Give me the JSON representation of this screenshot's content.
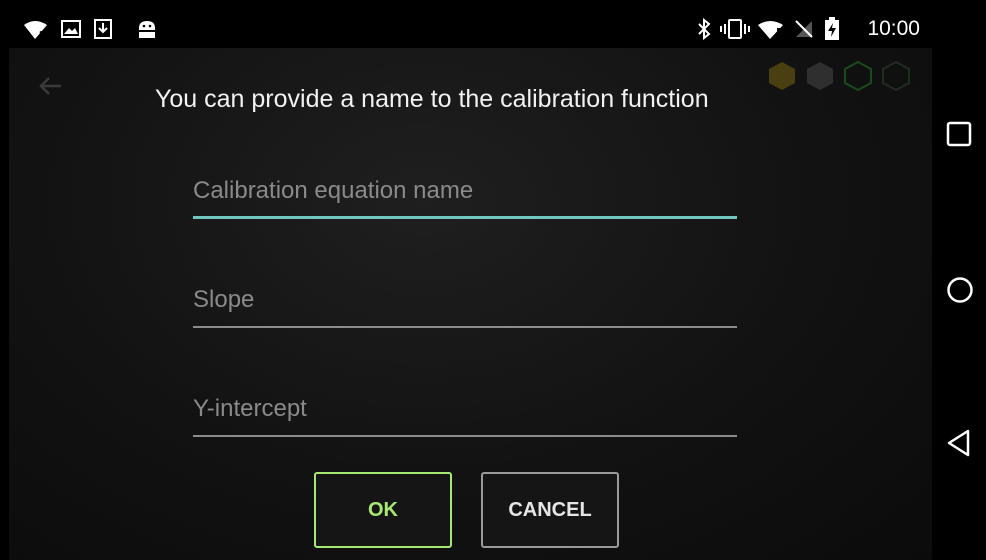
{
  "status_bar": {
    "time": "10:00",
    "left_icons": [
      "wifi-question-icon",
      "image-icon",
      "download-icon",
      "android-debug-icon"
    ],
    "right_icons": [
      "bluetooth-icon",
      "vibrate-icon",
      "wifi-alert-icon",
      "no-sim-icon",
      "battery-charging-icon"
    ]
  },
  "dialog": {
    "prompt": "You can provide a name to the calibration function",
    "fields": {
      "name": {
        "placeholder": "Calibration equation name",
        "value": ""
      },
      "slope": {
        "placeholder": "Slope",
        "value": ""
      },
      "intercept": {
        "placeholder": "Y-intercept",
        "value": ""
      }
    },
    "buttons": {
      "ok": "OK",
      "cancel": "CANCEL"
    }
  },
  "colors": {
    "focus_underline": "#6fc7bf",
    "ok_accent": "#a7e872",
    "hex_gold": "#6b5a12",
    "hex_green": "#1b4a1b"
  },
  "nav_bar": [
    "recents-square-icon",
    "home-circle-icon",
    "back-triangle-icon"
  ]
}
